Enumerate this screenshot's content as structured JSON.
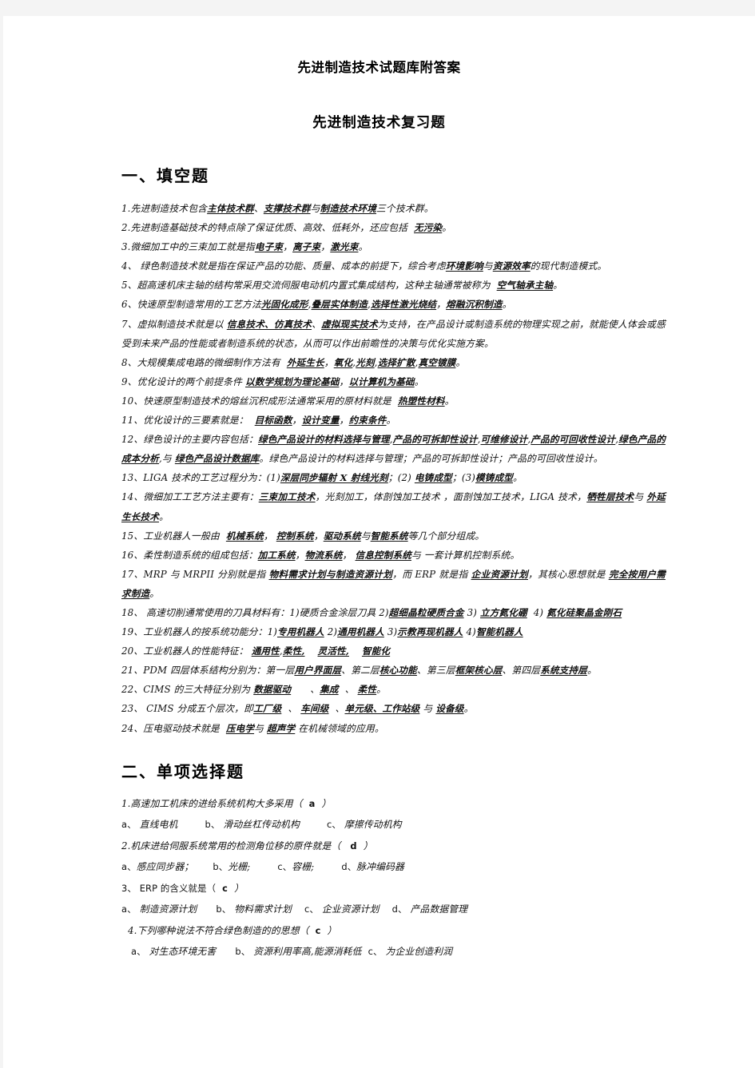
{
  "document": {
    "header_title": "先进制造技术试题库附答案",
    "title": "先进制造技术复习题"
  },
  "sections": [
    {
      "id": "fill-in-blank",
      "heading": "一、填空题"
    },
    {
      "id": "multiple-choice",
      "heading": "二、单项选择题"
    }
  ],
  "fill_in_blank": {
    "q1": {
      "lead": "1.先进制造技术包含",
      "a1": "主体技术群",
      "mid1": "、",
      "a2": "支撑技术群",
      "mid2": "与",
      "a3": "制造技术环境",
      "tail": "三个技术群。"
    },
    "q2": {
      "lead": "2.先进制造基础技术的特点除了保证优质、高效、低耗外，还应包括",
      "a1": "无污染",
      "tail": "。"
    },
    "q3": {
      "lead": "3.微细加工中的三束加工就是指",
      "a1": "电子束",
      "mid1": "，",
      "a2": "离子束",
      "mid2": "，",
      "a3": "激光束",
      "tail": "。"
    },
    "q4": {
      "lead": "4、 绿色制造技术就是指在保证产品的功能、质量、成本的前提下，综合考虑",
      "a1": "环境影响",
      "mid1": "与",
      "a2": "资源效率",
      "tail": "的现代制造模式。"
    },
    "q5": {
      "lead": "5、超高速机床主轴的结构常采用交流伺服电动机内置式集成结构，这种主轴通常被称为",
      "a1": "空气轴承主轴",
      "tail": "。"
    },
    "q6": {
      "lead": "6、快速原型制造常用的工艺方法",
      "a1": "光固化成形",
      "mid1": ",",
      "a2": "叠层实体制造",
      "mid2": ",",
      "a3": "选择性激光烧结",
      "mid3": "，",
      "a4": "熔融沉积制造",
      "tail": "。"
    },
    "q7": {
      "lead": "7、虚拟制造技术就是以",
      "a1": "信息技术、仿真技术",
      "mid1": "、",
      "a2": "虚拟现实技术",
      "tail": "为支持，在产品设计或制造系统的物理实现之前，就能使人体会或感受到未来产品的性能或者制造系统的状态，从而可以作出前瞻性的决策与优化实施方案。"
    },
    "q8": {
      "lead": "8、大规模集成电路的微细制作方法有",
      "a1": "外延生长",
      "mid1": "，",
      "a2": "氧化",
      "mid2": ",",
      "a3": "光刻",
      "mid3": ",",
      "a4": "选择扩散",
      "mid4": ",",
      "a5": "真空镀膜",
      "tail": "。"
    },
    "q9": {
      "lead": "9、优化设计的两个前提条件",
      "a1": "以数学规划为理论基础",
      "mid1": "，",
      "a2": "以计算机为基础",
      "tail": "。"
    },
    "q10": {
      "lead": "10、快速原型制造技术的熔丝沉积成形法通常采用的原材料就是",
      "a1": "热塑性材料",
      "tail": "。"
    },
    "q11": {
      "lead": "11、优化设计的三要素就是：",
      "a1": "目标函数",
      "mid1": "，",
      "a2": "设计变量",
      "mid2": "，",
      "a3": "约束条件",
      "tail": "。"
    },
    "q12": {
      "lead": "12、绿色设计的主要内容包括：",
      "a1": "绿色产品设计的材料选择与管理",
      "mid1": ",",
      "a2": "产品的可拆卸性设计",
      "mid2": ",",
      "a3": "可维修设计",
      "mid3": ",",
      "a4": "产品的可回收性设计",
      "mid4": ",",
      "a5": "绿色产品的成本分析",
      "mid5": ",与",
      "a6": "绿色产品设计数据库",
      "tail": "。绿色产品设计的材料选择与管理；产品的可拆卸性设计；产品的可回收性设计。"
    },
    "q13": {
      "lead": "13、LIGA 技术的工艺过程分为：(1)",
      "a1": "深层同步辐射 X 射线光刻",
      "mid1": "；(2)",
      "a2": "电铸成型",
      "mid2": "；(3)",
      "a3": "模铸成型",
      "tail": "。"
    },
    "q14": {
      "lead": "14、微细加工工艺方法主要有：",
      "a1": "三束加工技术",
      "mid1": "，光刻加工，体剖蚀加工技术 ，面剖蚀加工技术，LIGA 技术，",
      "a2": "牺牲层技术",
      "mid2": "与",
      "a3": "外延生长技术",
      "tail": "。"
    },
    "q15": {
      "lead": "15、工业机器人一般由",
      "a1": "机械系统",
      "mid1": "，",
      "a2": "控制系统",
      "mid2": "，",
      "a3": "驱动系统",
      "mid3": "与",
      "a4": "智能系统",
      "tail": "等几个部分组成。"
    },
    "q16": {
      "lead": "16、柔性制造系统的组成包括：",
      "a1": "加工系统",
      "mid1": "，",
      "a2": "物流系统",
      "mid2": "，",
      "a3": "信息控制系统",
      "tail": "与 一套计算机控制系统。"
    },
    "q17": {
      "lead": "17、MRP 与 MRPII 分别就是指",
      "a1": "物料需求计划与制造资源计划",
      "mid1": "，而 ERP 就是指",
      "a2": "企业资源计划",
      "mid2": "，其核心思想就是",
      "a3": "完全按用户需求制造",
      "tail": "。"
    },
    "q18": {
      "lead": "18、 高速切削通常使用的刀具材料有：1)硬质合金涂层刀具 2)",
      "a1": "超细晶粒硬质合金",
      "mid1": "3)",
      "a2": "立方氮化硼",
      "mid2": "4)",
      "a3": "氮化硅聚晶金刚石",
      "tail": ""
    },
    "q19": {
      "lead": "19、工业机器人的按系统功能分：1)",
      "a1": "专用机器人",
      "mid1": "2)",
      "a2": "通用机器人",
      "mid2": "3)",
      "a3": "示教再现机器人",
      "mid3": "4)",
      "a4": "智能机器人",
      "tail": ""
    },
    "q20": {
      "lead": "20、工业机器人的性能特征：",
      "a1": "通用性",
      "mid1": ",",
      "a2": "柔性,",
      "mid2": "",
      "a3": "灵活性,",
      "mid3": "",
      "a4": "智能化",
      "tail": ""
    },
    "q21": {
      "lead": "21、PDM 四层体系结构分别为：第一层",
      "a1": "用户界面层",
      "mid1": "、第二层",
      "a2": "核心功能",
      "mid2": "、第三层",
      "a3": "框架核心层",
      "mid3": "、第四层",
      "a4": "系统支持层",
      "tail": "。"
    },
    "q22": {
      "lead": "22、CIMS 的三大特征分别为",
      "a1": "数据驱动",
      "mid1": "、",
      "a2": "集成",
      "mid2": "、",
      "a3": "柔性",
      "tail": "。"
    },
    "q23": {
      "lead": "23、 CIMS 分成五个层次，即",
      "a1": "工厂级",
      "mid1": "、",
      "a2": "车间级",
      "mid2": "、",
      "a3": "单元级、工作站级",
      "mid3": "与",
      "a4": "设备级",
      "tail": "。"
    },
    "q24": {
      "lead": "24、压电驱动技术就是",
      "a1": "压电学",
      "mid1": "与",
      "a2": "超声学",
      "tail": "在机械领域的应用。"
    }
  },
  "multiple_choice": [
    {
      "stem": "1.高速加工机床的进给系统机构大多采用（",
      "answer": "a",
      "stem_end": "）",
      "options": [
        {
          "label": "a、",
          "text": "直线电机"
        },
        {
          "label": "b、",
          "text": "滑动丝杠传动机构"
        },
        {
          "label": "c、",
          "text": "摩擦传动机构"
        }
      ]
    },
    {
      "stem": "2.机床进给伺服系统常用的检测角位移的原件就是（",
      "answer": "d",
      "stem_end": "）",
      "options": [
        {
          "label": "a、",
          "text": "感应同步器；"
        },
        {
          "label": "b、",
          "text": "光栅;"
        },
        {
          "label": "c、",
          "text": "容栅;"
        },
        {
          "label": "d、",
          "text": "脉冲编码器"
        }
      ]
    },
    {
      "stem": "3、 ERP 的含义就是（",
      "answer": "c",
      "stem_end": "）",
      "options": [
        {
          "label": "a、",
          "text": "制造资源计划"
        },
        {
          "label": "b、",
          "text": "物料需求计划"
        },
        {
          "label": "c、",
          "text": "企业资源计划"
        },
        {
          "label": "d、",
          "text": "产品数据管理"
        }
      ]
    },
    {
      "stem": "4.下列哪种说法不符合绿色制造的的思想（",
      "answer": "c",
      "stem_end": "）",
      "options": [
        {
          "label": "a、",
          "text": "对生态环境无害"
        },
        {
          "label": "b、",
          "text": "资源利用率高,能源消耗低"
        },
        {
          "label": "c、",
          "text": "为企业创造利润"
        }
      ]
    }
  ],
  "colors": {
    "page_background": "#ffffff",
    "canvas_background": "#f4f4f4",
    "text": "#111111"
  }
}
